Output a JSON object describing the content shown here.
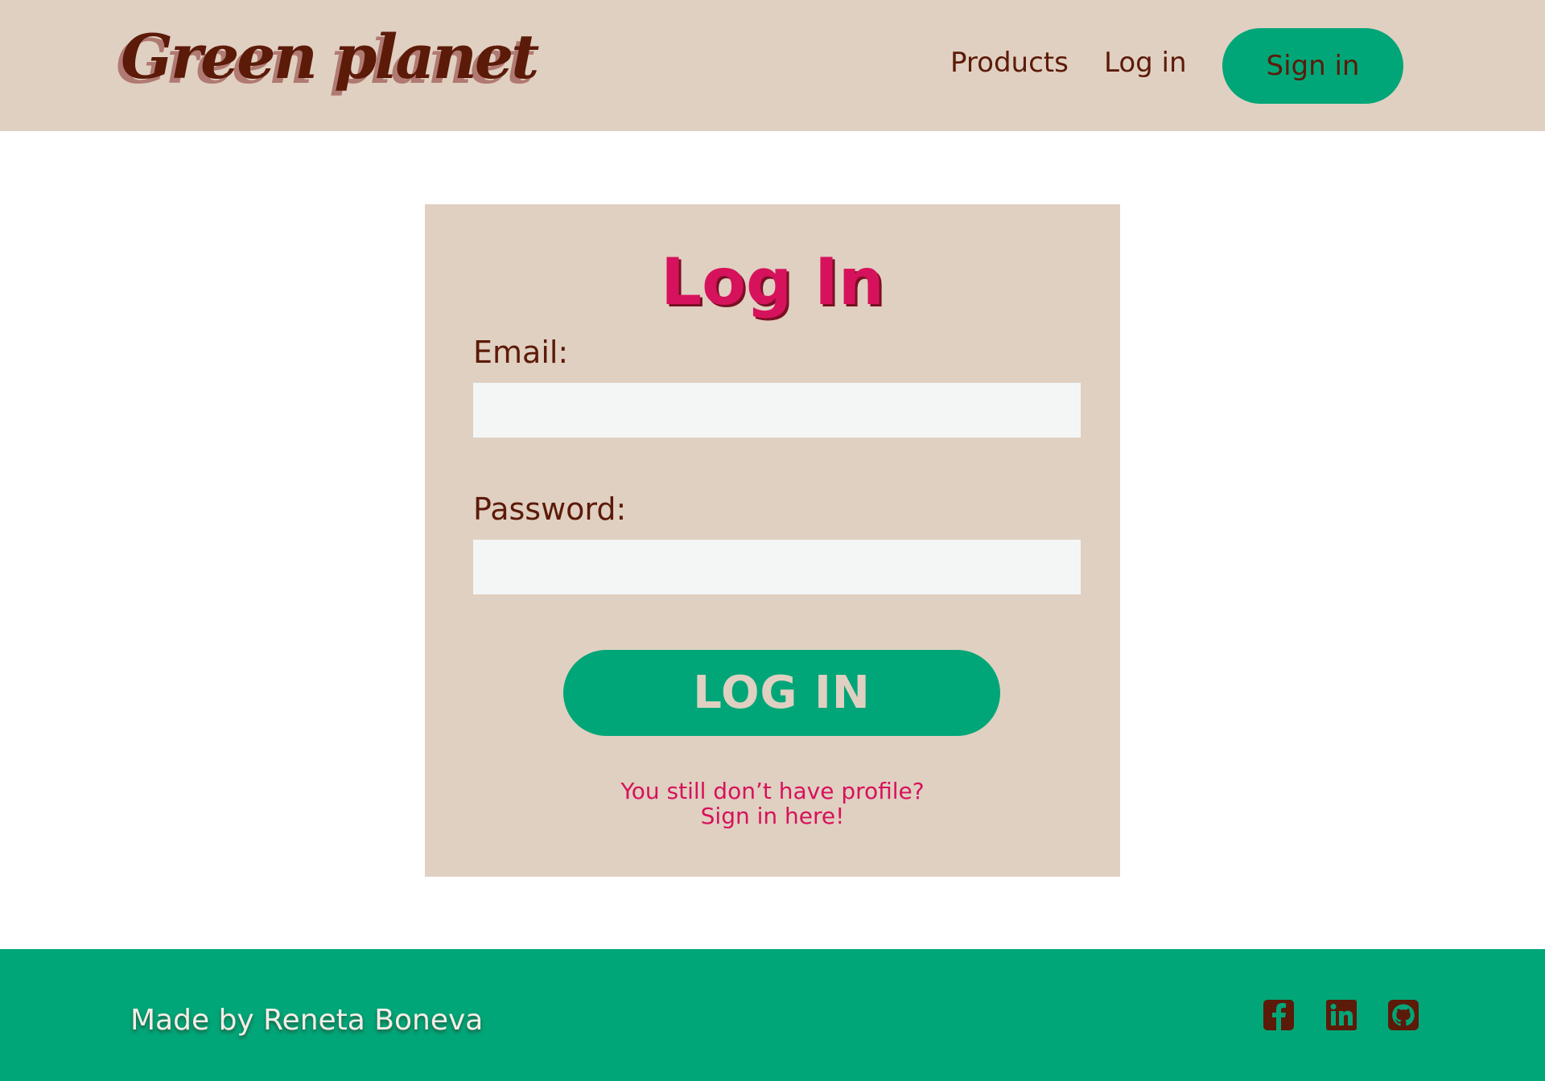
{
  "header": {
    "logo": "Green planet",
    "nav": {
      "products": "Products",
      "login": "Log in",
      "signin": "Sign in"
    }
  },
  "login_card": {
    "title": "Log In",
    "email_label": "Email:",
    "email_value": "",
    "password_label": "Password:",
    "password_value": "",
    "submit_label": "LOG IN",
    "hint_line1": "You still don’t have profile?",
    "hint_link": "Sign in here!"
  },
  "footer": {
    "credit": "Made by Reneta Boneva",
    "social_icons": [
      "facebook-icon",
      "linkedin-icon",
      "github-icon"
    ]
  },
  "colors": {
    "header_bg": "#e0d0c1",
    "brand_brown": "#5c1a09",
    "accent_green": "#00a678",
    "accent_pink": "#d6125c",
    "input_bg": "#f4f6f6"
  }
}
